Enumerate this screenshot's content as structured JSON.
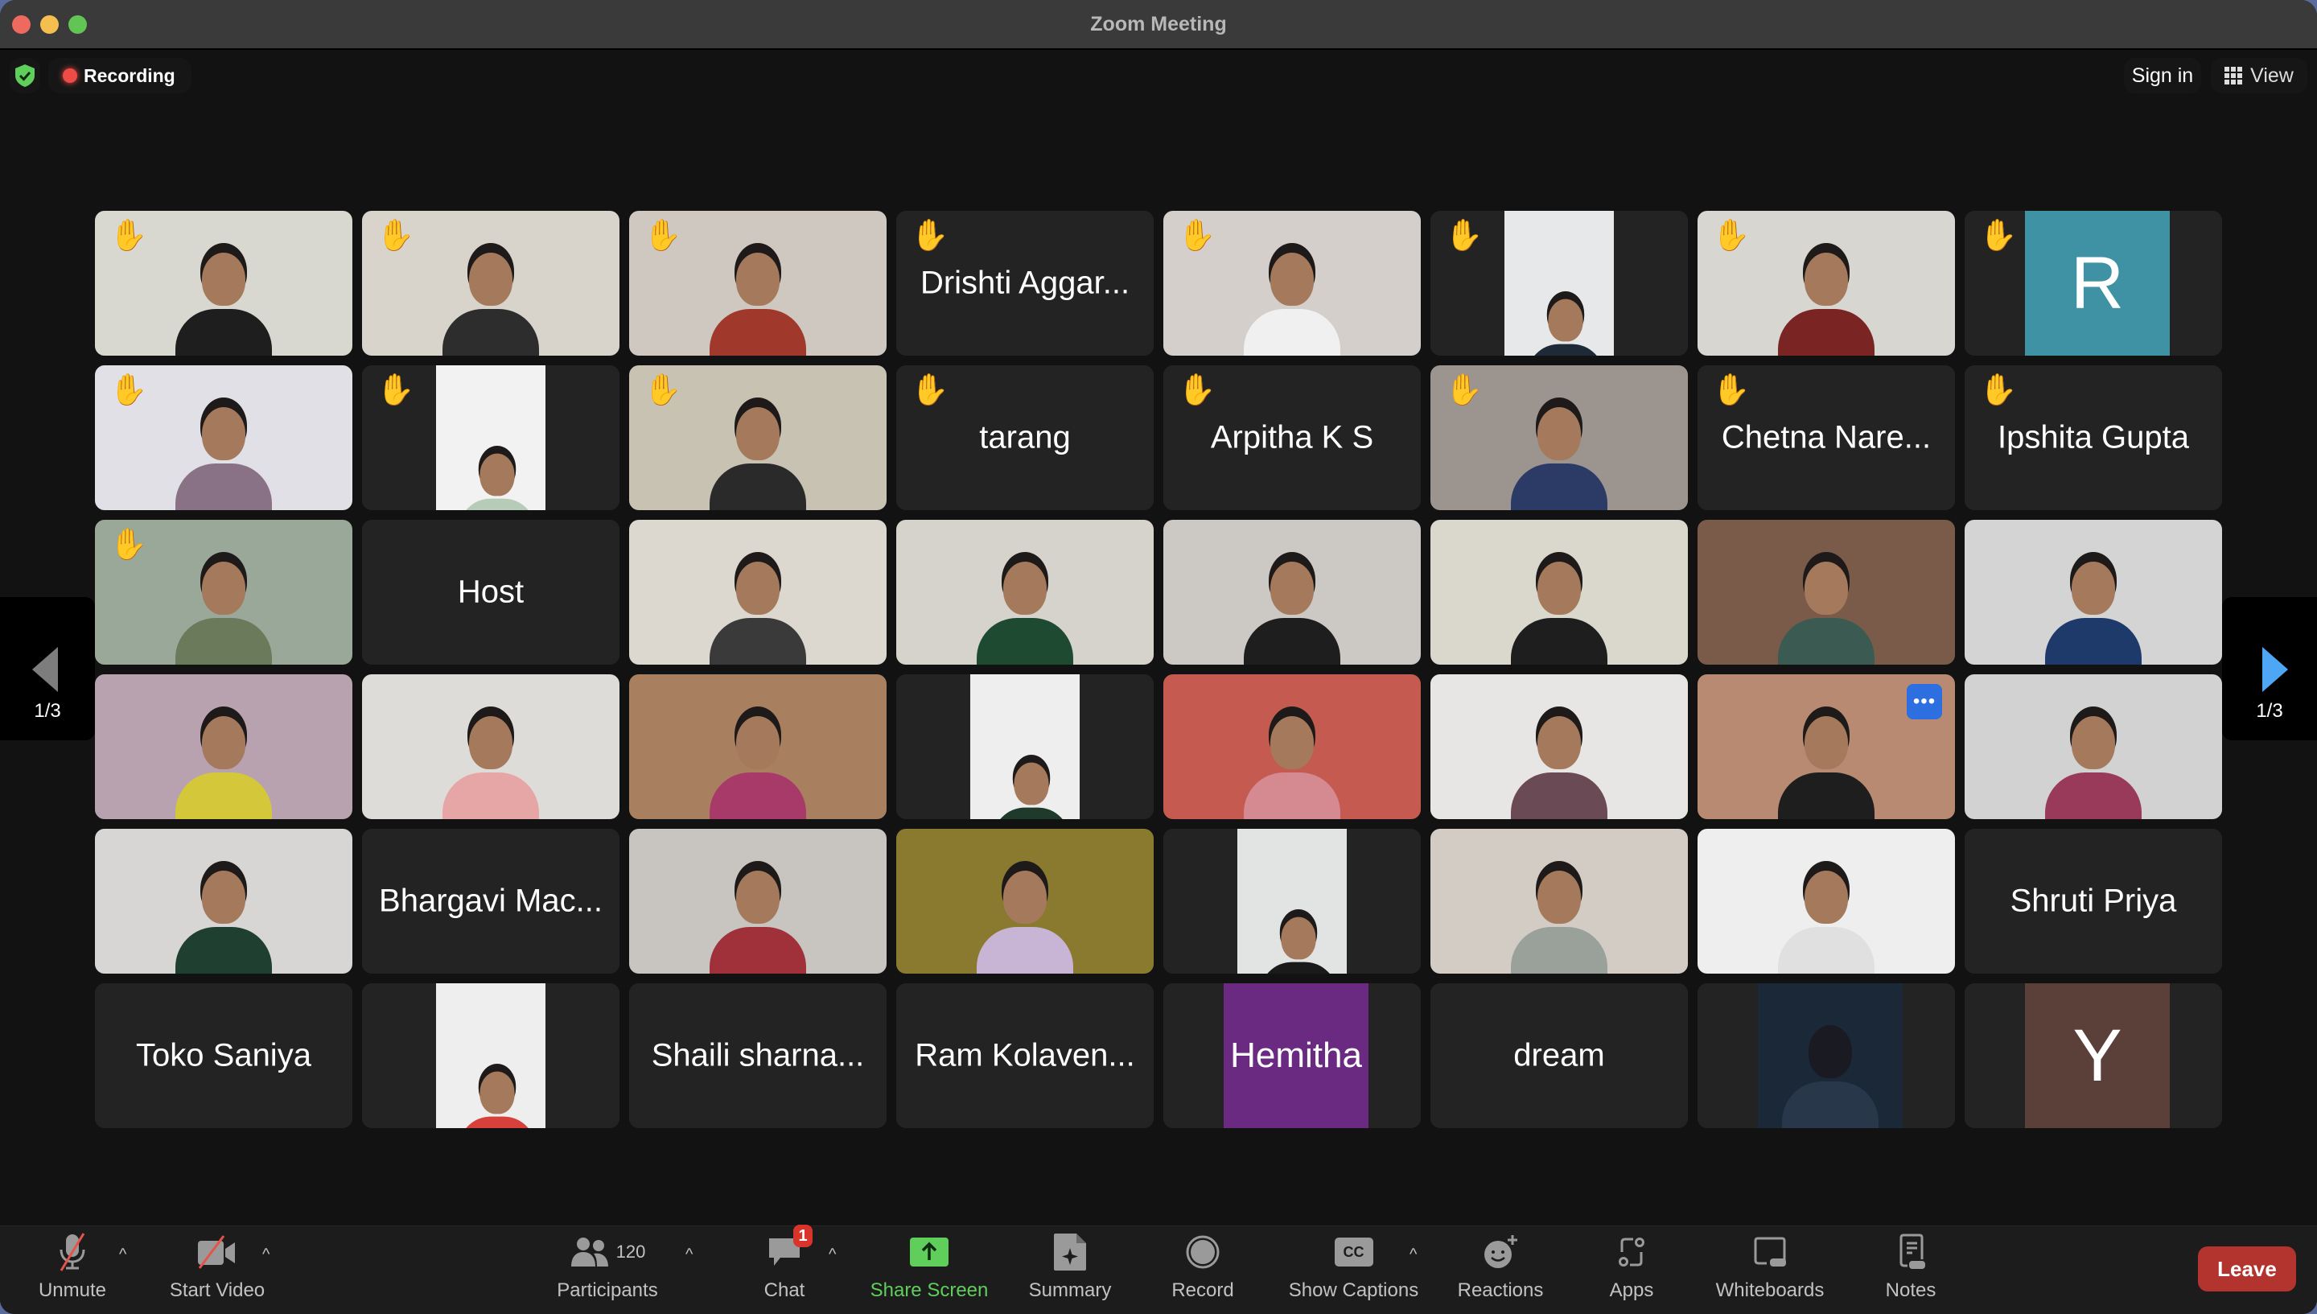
{
  "window": {
    "title": "Zoom Meeting"
  },
  "topbar": {
    "security_icon": "shield-check-icon",
    "recording_label": "Recording",
    "sign_in_label": "Sign in",
    "view_label": "View"
  },
  "pagination": {
    "left_page": "1/3",
    "right_page": "1/3"
  },
  "colors": {
    "active_speaker_border": "#5fce5b",
    "share_screen_green": "#5fce5b",
    "leave_red": "#b3332e",
    "next_arrow_blue": "#4ea7f5",
    "raised_hand": "#f6c343"
  },
  "hand_emoji": "✋",
  "tiles": [
    {
      "type": "video",
      "hand": true,
      "bg": "#d9d8d0",
      "shirt": "#1e1e1e"
    },
    {
      "type": "video",
      "hand": true,
      "bg": "#d8d4cc",
      "shirt": "#2d2d2d"
    },
    {
      "type": "video",
      "hand": true,
      "bg": "#cfc8c0",
      "shirt": "#a0392b"
    },
    {
      "type": "name",
      "hand": true,
      "name": "Drishti Aggar..."
    },
    {
      "type": "video",
      "hand": true,
      "bg": "#d5cfcc",
      "shirt": "#f0f0f0"
    },
    {
      "type": "portrait",
      "hand": true,
      "bg": "#e6e8ea",
      "shirt": "#1f2a38"
    },
    {
      "type": "video",
      "hand": true,
      "bg": "#d8d6d0",
      "shirt": "#7a2424"
    },
    {
      "type": "avatar",
      "hand": true,
      "letter": "R",
      "color": "#3e92a3"
    },
    {
      "type": "video",
      "hand": true,
      "bg": "#e0e0e6",
      "shirt": "#8a7286"
    },
    {
      "type": "portrait",
      "hand": true,
      "bg": "#f2f2f2",
      "shirt": "#b6cbb8"
    },
    {
      "type": "video",
      "hand": true,
      "bg": "#c8c2b2",
      "shirt": "#2a2a2a"
    },
    {
      "type": "name",
      "hand": true,
      "name": "tarang"
    },
    {
      "type": "name",
      "hand": true,
      "name": "Arpitha K S"
    },
    {
      "type": "video",
      "hand": true,
      "bg": "#9c948e",
      "shirt": "#2c3a66"
    },
    {
      "type": "name",
      "hand": true,
      "name": "Chetna Nare..."
    },
    {
      "type": "name",
      "hand": true,
      "name": "Ipshita Gupta"
    },
    {
      "type": "video",
      "hand": true,
      "bg": "#9aa89a",
      "shirt": "#6a7a5a"
    },
    {
      "type": "name",
      "hand": false,
      "name": "Host"
    },
    {
      "type": "video",
      "hand": false,
      "bg": "#dcd7cf",
      "shirt": "#3a3a3a"
    },
    {
      "type": "video",
      "hand": false,
      "bg": "#d6d2cc",
      "shirt": "#1f4a32"
    },
    {
      "type": "video",
      "hand": false,
      "bg": "#ccc8c4",
      "shirt": "#1e1e1e"
    },
    {
      "type": "video",
      "hand": false,
      "bg": "#dad8cc",
      "shirt": "#1e1e1e"
    },
    {
      "type": "video",
      "hand": false,
      "bg": "#7a5a48",
      "shirt": "#3a5a52"
    },
    {
      "type": "video",
      "hand": false,
      "bg": "#d4d4d4",
      "shirt": "#1e3a6a"
    },
    {
      "type": "video",
      "hand": false,
      "bg": "#b8a2b0",
      "shirt": "#d4c83a"
    },
    {
      "type": "video",
      "hand": false,
      "bg": "#dedcd8",
      "shirt": "#e7a6a6"
    },
    {
      "type": "video",
      "hand": false,
      "bg": "#a88060",
      "shirt": "#a83a6a"
    },
    {
      "type": "portrait",
      "hand": false,
      "bg": "#eeeeee",
      "shirt": "#1f3a2a"
    },
    {
      "type": "video",
      "hand": false,
      "bg": "#c45a50",
      "shirt": "#d48a90"
    },
    {
      "type": "video",
      "hand": false,
      "bg": "#e8e6e4",
      "shirt": "#6a4a54",
      "active": true
    },
    {
      "type": "video",
      "hand": false,
      "bg": "#b88a72",
      "shirt": "#1e1e1e",
      "more": true
    },
    {
      "type": "video",
      "hand": false,
      "bg": "#d2d2d2",
      "shirt": "#9a3a5a"
    },
    {
      "type": "video",
      "hand": false,
      "bg": "#d8d6d4",
      "shirt": "#1f4030"
    },
    {
      "type": "name",
      "hand": false,
      "name": "Bhargavi Mac..."
    },
    {
      "type": "video",
      "hand": false,
      "bg": "#c8c4c0",
      "shirt": "#a0303a"
    },
    {
      "type": "video",
      "hand": false,
      "bg": "#8a7a30",
      "shirt": "#c8b4d4"
    },
    {
      "type": "portrait",
      "hand": false,
      "bg": "#e2e4e4",
      "shirt": "#1a1a1a"
    },
    {
      "type": "video",
      "hand": false,
      "bg": "#d2ccc4",
      "shirt": "#9aa09a"
    },
    {
      "type": "video",
      "hand": false,
      "bg": "#eeeeee",
      "shirt": "#e0e0e0"
    },
    {
      "type": "name",
      "hand": false,
      "name": "Shruti Priya"
    },
    {
      "type": "name",
      "hand": false,
      "name": "Toko Saniya"
    },
    {
      "type": "portrait",
      "hand": false,
      "bg": "#eeeeee",
      "shirt": "#d8403c"
    },
    {
      "type": "name",
      "hand": false,
      "name": "Shaili sharna..."
    },
    {
      "type": "name",
      "hand": false,
      "name": "Ram Kolaven..."
    },
    {
      "type": "avatar-text",
      "hand": false,
      "letter": "Hemitha",
      "color": "#6a2a82"
    },
    {
      "type": "name",
      "hand": false,
      "name": "dream"
    },
    {
      "type": "portrait-wide",
      "hand": false,
      "bg": "#1a2838",
      "shirt": "#28384a"
    },
    {
      "type": "avatar",
      "hand": false,
      "letter": "Y",
      "color": "#5a4038"
    }
  ],
  "toolbar": {
    "unmute_label": "Unmute",
    "start_video_label": "Start Video",
    "participants_label": "Participants",
    "participants_count": "120",
    "chat_label": "Chat",
    "chat_badge": "1",
    "share_screen_label": "Share Screen",
    "summary_label": "Summary",
    "record_label": "Record",
    "captions_label": "Show Captions",
    "captions_icon_text": "CC",
    "reactions_label": "Reactions",
    "apps_label": "Apps",
    "whiteboards_label": "Whiteboards",
    "notes_label": "Notes",
    "leave_label": "Leave",
    "caret": "^"
  }
}
